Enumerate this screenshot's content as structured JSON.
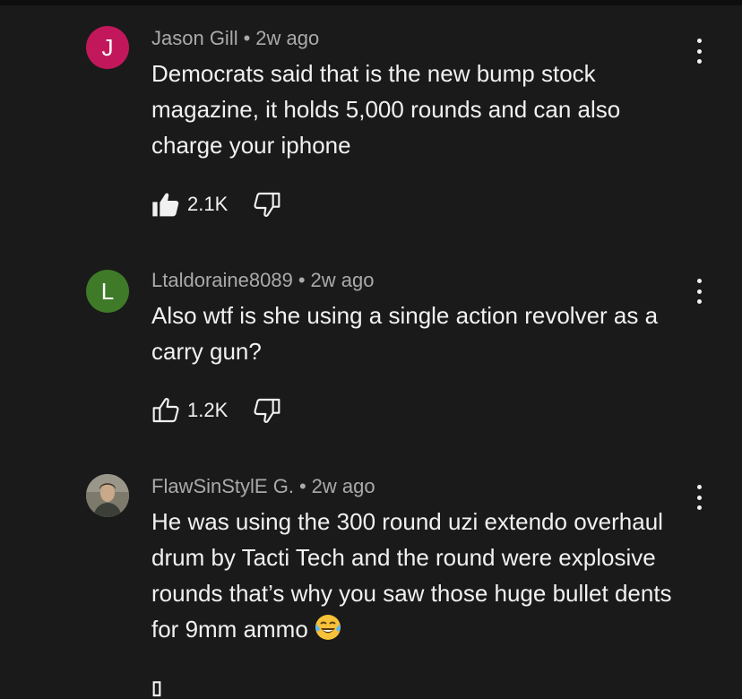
{
  "comments": [
    {
      "author": "Jason Gill",
      "separator": "•",
      "time": "2w ago",
      "avatar_letter": "J",
      "avatar_color": "#c2185b",
      "text": "Democrats said that is the new bump stock magazine, it holds 5,000 rounds and can also charge your iphone",
      "likes": "2.1K",
      "liked": true
    },
    {
      "author": "Ltaldoraine8089",
      "separator": "•",
      "time": "2w ago",
      "avatar_letter": "L",
      "avatar_color": "#3f7a28",
      "text": "Also wtf is she using a single action revolver as a carry gun?",
      "likes": "1.2K",
      "liked": false
    },
    {
      "author": "FlawSinStylE G.",
      "separator": "•",
      "time": "2w ago",
      "avatar_letter": "",
      "avatar_color": "#6b6b5e",
      "text": "He was using the 300 round uzi extendo overhaul drum by Tacti Tech and the round were explosive rounds that’s why you saw those huge bullet dents for 9mm ammo",
      "text_emoji": "face-with-tears-of-joy-emoji"
    }
  ],
  "icons": {
    "like": "thumbs-up-icon",
    "dislike": "thumbs-down-icon",
    "more": "more-vertical-icon"
  }
}
